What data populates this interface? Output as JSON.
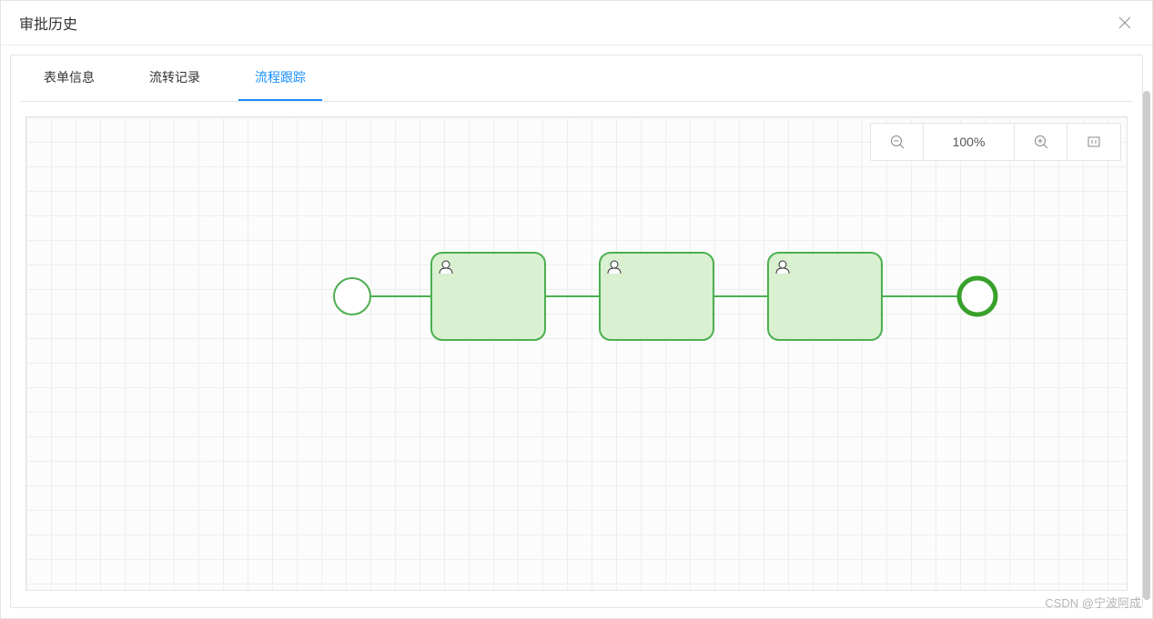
{
  "modal": {
    "title": "审批历史"
  },
  "tabs": [
    {
      "label": "表单信息",
      "active": false
    },
    {
      "label": "流转记录",
      "active": false
    },
    {
      "label": "流程跟踪",
      "active": true
    }
  ],
  "zoom": {
    "level": "100%"
  },
  "watermark": "CSDN @宁波阿成",
  "diagram": {
    "start": {
      "type": "start-event"
    },
    "tasks": [
      {
        "type": "user-task"
      },
      {
        "type": "user-task"
      },
      {
        "type": "user-task"
      }
    ],
    "end": {
      "type": "end-event"
    },
    "colors": {
      "stroke": "#4caf50",
      "fill": "#d9f0d1",
      "endStroke": "#38a12c"
    }
  }
}
